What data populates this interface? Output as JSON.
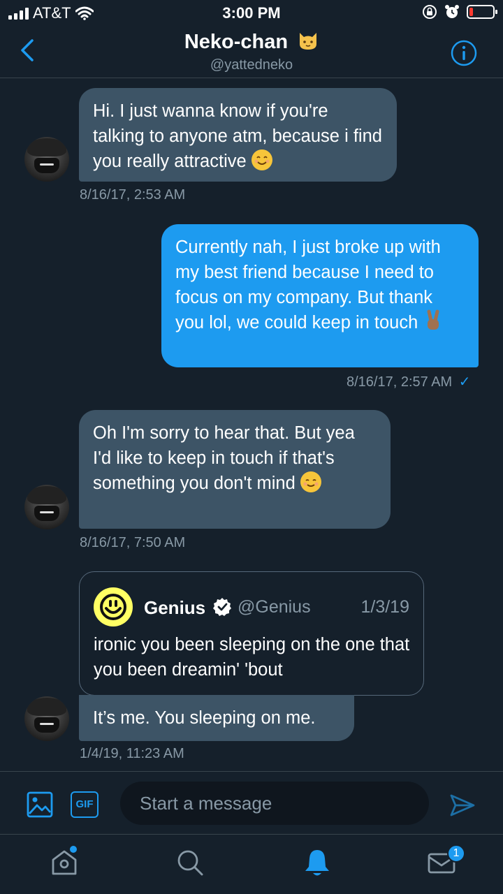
{
  "status_bar": {
    "carrier": "AT&T",
    "time": "3:00 PM"
  },
  "header": {
    "name": "Neko-chan",
    "handle": "@yattedneko"
  },
  "messages": [
    {
      "direction": "incoming",
      "text": "Hi. I just wanna know if you're talking to anyone atm, because i find you really attractive",
      "emoji": "smiling-face-with-smiling-eyes",
      "timestamp": "8/16/17, 2:53 AM"
    },
    {
      "direction": "outgoing",
      "text": "Currently nah, I just broke up with my best friend because I need to focus on my company. But thank you lol, we could keep in touch",
      "emoji": "victory-hand",
      "timestamp": "8/16/17, 2:57 AM",
      "read_mark": "✓"
    },
    {
      "direction": "incoming",
      "text": "Oh I'm sorry to hear that. But yea I'd like to keep in touch if that's something you don't mind",
      "emoji": "smiling-face",
      "timestamp": "8/16/17, 7:50 AM"
    },
    {
      "direction": "incoming",
      "quoted_tweet": {
        "name": "Genius",
        "handle": "@Genius",
        "date": "1/3/19",
        "text": "ironic you been sleeping on the one that you been dreamin' 'bout"
      },
      "text": "It’s me. You sleeping on me.",
      "timestamp": "1/4/19, 11:23 AM"
    }
  ],
  "composer": {
    "gif_label": "GIF",
    "placeholder": "Start a message"
  },
  "tabbar": {
    "messages_badge": "1"
  },
  "colors": {
    "background": "#15202b",
    "incoming_bubble": "#3d5466",
    "outgoing_bubble": "#1d9bf0",
    "accent": "#1d9bf0",
    "muted_text": "#8899a6"
  }
}
